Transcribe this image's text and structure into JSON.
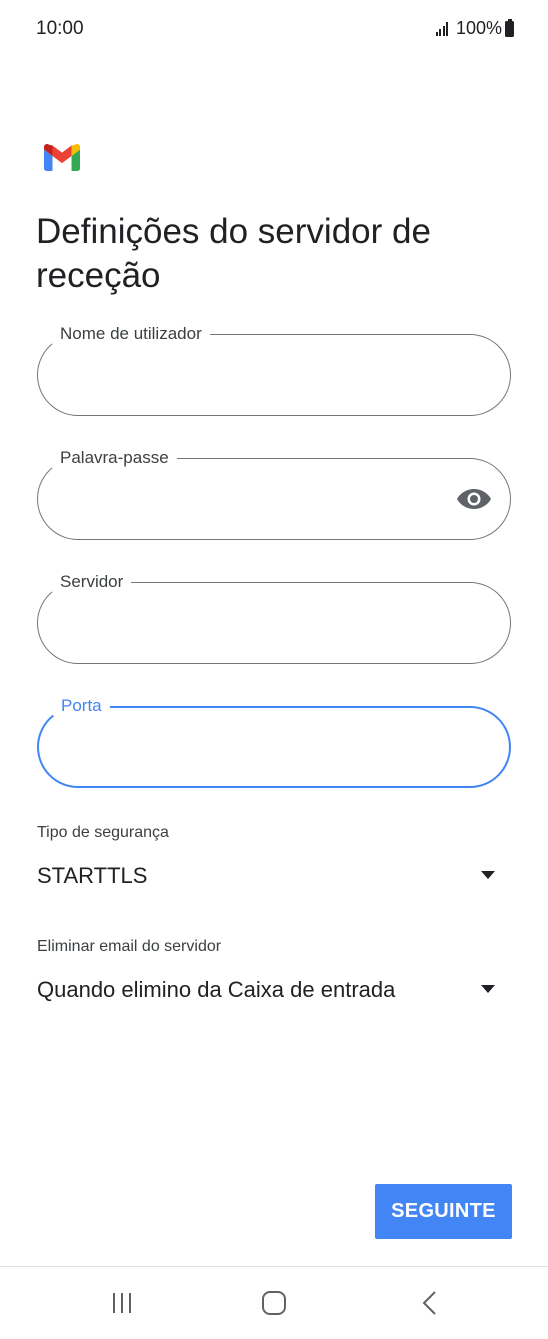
{
  "status_bar": {
    "time": "10:00",
    "battery_text": "100%",
    "signal_icon": "signal-bars-icon",
    "battery_icon": "battery-full-icon"
  },
  "app": {
    "logo_icon": "gmail-logo-icon"
  },
  "page": {
    "title": "Definições do servidor de receção"
  },
  "fields": {
    "username": {
      "label": "Nome de utilizador",
      "value": ""
    },
    "password": {
      "label": "Palavra-passe",
      "value": "",
      "toggle_icon": "eye-icon"
    },
    "server": {
      "label": "Servidor",
      "value": ""
    },
    "port": {
      "label": "Porta",
      "value": "",
      "focused": true
    }
  },
  "selects": {
    "security_type": {
      "label": "Tipo de segurança",
      "value": "STARTTLS"
    },
    "delete_email": {
      "label": "Eliminar email do servidor",
      "value": "Quando elimino da Caixa de entrada"
    }
  },
  "actions": {
    "next_label": "SEGUINTE"
  },
  "navigation": {
    "recent_icon": "recent-apps-icon",
    "home_icon": "home-icon",
    "back_icon": "back-icon"
  },
  "colors": {
    "accent": "#4285f4",
    "border": "#747775",
    "text": "#202124"
  }
}
